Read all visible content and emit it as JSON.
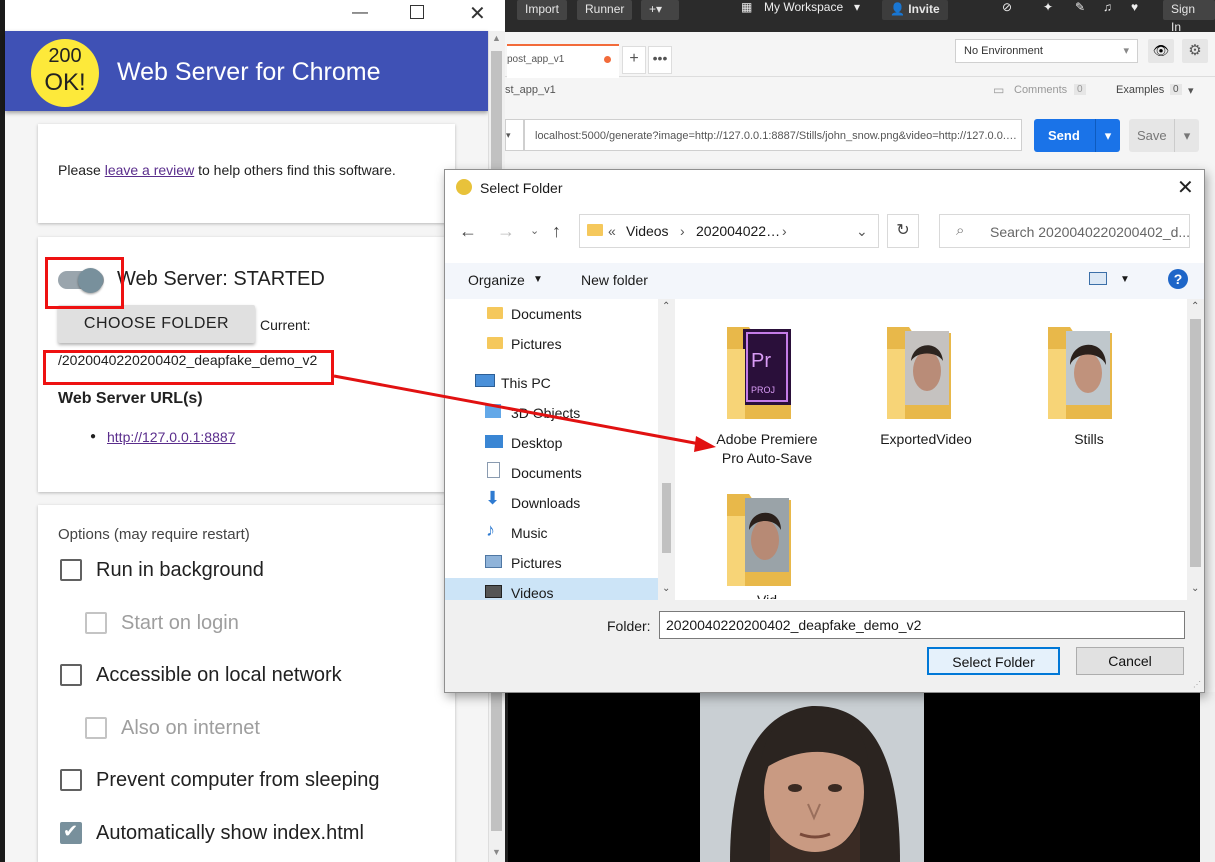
{
  "postman": {
    "import": "Import",
    "runner": "Runner",
    "workspace": "My Workspace",
    "invite": "Invite",
    "sign_in": "Sign In",
    "tab_name": "post_app_v1",
    "request_name": "st_app_v1",
    "environment": "No Environment",
    "comments": "Comments",
    "comments_count": "0",
    "examples": "Examples",
    "examples_count": "0",
    "url": "localhost:5000/generate?image=http://127.0.0.1:8887/Stills/john_snow.png&video=http://127.0.0.…",
    "send": "Send",
    "save": "Save"
  },
  "wsc": {
    "app_title": "Web Server for Chrome",
    "logo_text_top": "200",
    "logo_text_bottom": "OK!",
    "review_prefix": "Please ",
    "review_link": "leave a review",
    "review_suffix": " to help others find this software.",
    "server_status": "Web Server: STARTED",
    "choose_folder": "CHOOSE FOLDER",
    "current_label": "Current:",
    "current_path": "/2020040220200402_deapfake_demo_v2",
    "urls_heading": "Web Server URL(s)",
    "url": "http://127.0.0.1:8887",
    "options_heading": "Options (may require restart)",
    "options": [
      {
        "label": "Run in background",
        "checked": false,
        "disabled": false
      },
      {
        "label": "Start on login",
        "checked": false,
        "disabled": true
      },
      {
        "label": "Accessible on local network",
        "checked": false,
        "disabled": false
      },
      {
        "label": "Also on internet",
        "checked": false,
        "disabled": true
      },
      {
        "label": "Prevent computer from sleeping",
        "checked": false,
        "disabled": false
      },
      {
        "label": "Automatically show index.html",
        "checked": true,
        "disabled": false
      }
    ]
  },
  "dialog": {
    "title": "Select Folder",
    "breadcrumb_prefix": "«",
    "breadcrumb_1": "Videos",
    "breadcrumb_2": "202004022…",
    "search_placeholder": "Search 2020040220200402_d...",
    "organize": "Organize",
    "new_folder": "New folder",
    "nav_items": [
      {
        "label": "Documents",
        "icon": "folder-icon"
      },
      {
        "label": "Pictures",
        "icon": "folder-icon"
      },
      {
        "label": "This PC",
        "icon": "computer-icon"
      },
      {
        "label": "3D Objects",
        "icon": "cube-icon"
      },
      {
        "label": "Desktop",
        "icon": "desktop-icon"
      },
      {
        "label": "Documents",
        "icon": "document-icon"
      },
      {
        "label": "Downloads",
        "icon": "download-icon"
      },
      {
        "label": "Music",
        "icon": "music-icon"
      },
      {
        "label": "Pictures",
        "icon": "pictures-icon"
      },
      {
        "label": "Videos",
        "icon": "video-icon"
      }
    ],
    "folders": [
      {
        "label_line1": "Adobe Premiere",
        "label_line2": "Pro Auto-Save"
      },
      {
        "label_line1": "ExportedVideo",
        "label_line2": ""
      },
      {
        "label_line1": "Stills",
        "label_line2": ""
      },
      {
        "label_line1": "Vid",
        "label_line2": ""
      }
    ],
    "folder_label": "Folder:",
    "folder_value": "2020040220200402_deapfake_demo_v2",
    "select_button": "Select Folder",
    "cancel_button": "Cancel"
  },
  "colors": {
    "header_blue": "#3f51b5",
    "annotation_red": "#e11111",
    "postman_blue": "#1a73e8"
  }
}
